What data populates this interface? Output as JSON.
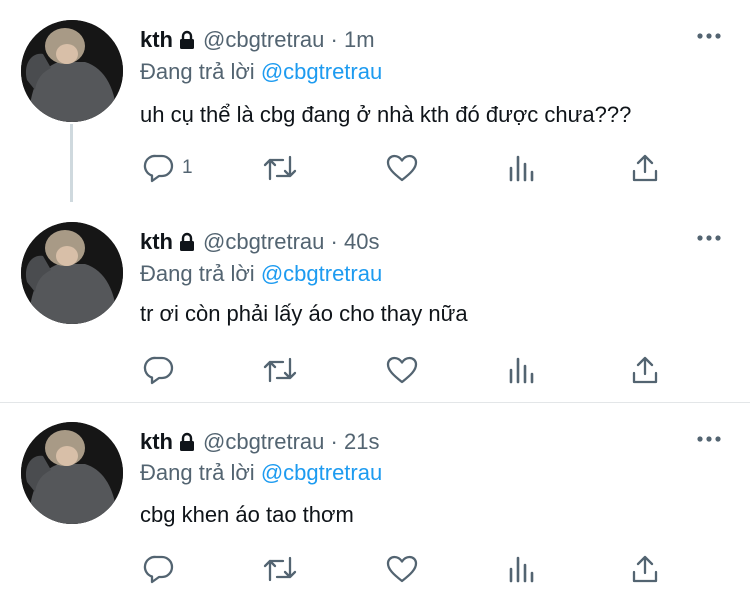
{
  "tweets": [
    {
      "name": "kth",
      "handle": "@cbgtretrau",
      "separator": "·",
      "time": "1m",
      "reply_prefix": "Đang trả lời",
      "reply_to": "@cbgtretrau",
      "text": "uh cụ thể là cbg đang ở nhà kth đó được chưa???",
      "reply_count": "1"
    },
    {
      "name": "kth",
      "handle": "@cbgtretrau",
      "separator": "·",
      "time": "40s",
      "reply_prefix": "Đang trả lời",
      "reply_to": "@cbgtretrau",
      "text": "tr ơi còn phải lấy áo cho thay nữa",
      "reply_count": ""
    },
    {
      "name": "kth",
      "handle": "@cbgtretrau",
      "separator": "·",
      "time": "21s",
      "reply_prefix": "Đang trả lời",
      "reply_to": "@cbgtretrau",
      "text": "cbg khen áo tao thơm",
      "reply_count": ""
    }
  ],
  "colors": {
    "text": "#0f1419",
    "secondary": "#536471",
    "link": "#1d9bf0",
    "divider": "#e3e6e8",
    "thread_line": "#cfd9de"
  },
  "icons": [
    "lock-icon",
    "more-icon",
    "reply-icon",
    "retweet-icon",
    "like-icon",
    "views-icon",
    "share-icon"
  ]
}
